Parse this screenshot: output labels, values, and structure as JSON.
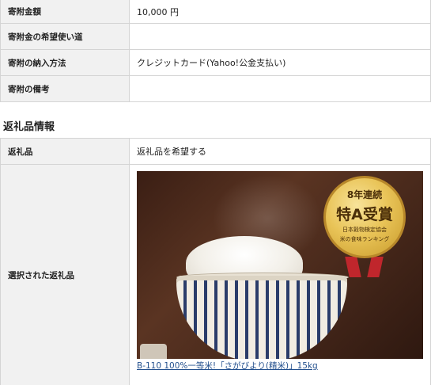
{
  "donation_info": {
    "rows": [
      {
        "label": "寄附金額",
        "value": "10,000 円"
      },
      {
        "label": "寄附金の希望使い道",
        "value": ""
      },
      {
        "label": "寄附の納入方法",
        "value": "クレジットカード(Yahoo!公金支払い)"
      },
      {
        "label": "寄附の備考",
        "value": ""
      }
    ]
  },
  "gift_section": {
    "title": "返礼品情報",
    "gift_row": {
      "label": "返礼品",
      "value": "返礼品を希望する"
    },
    "selected": {
      "label": "選択された返礼品",
      "badge": {
        "line1": "8年連続",
        "line2": "特A受賞",
        "line3": "日本穀物検定協会",
        "line4": "米の食味ランキング"
      },
      "link_text": "B-110 100%一等米!「さがびより(精米)」15kg"
    }
  },
  "colors": {
    "label_bg": "#f1f1f1",
    "border": "#d4d4d4",
    "link": "#23508e",
    "badge_gold": "#e9c458",
    "ribbon": "#c0262c"
  }
}
